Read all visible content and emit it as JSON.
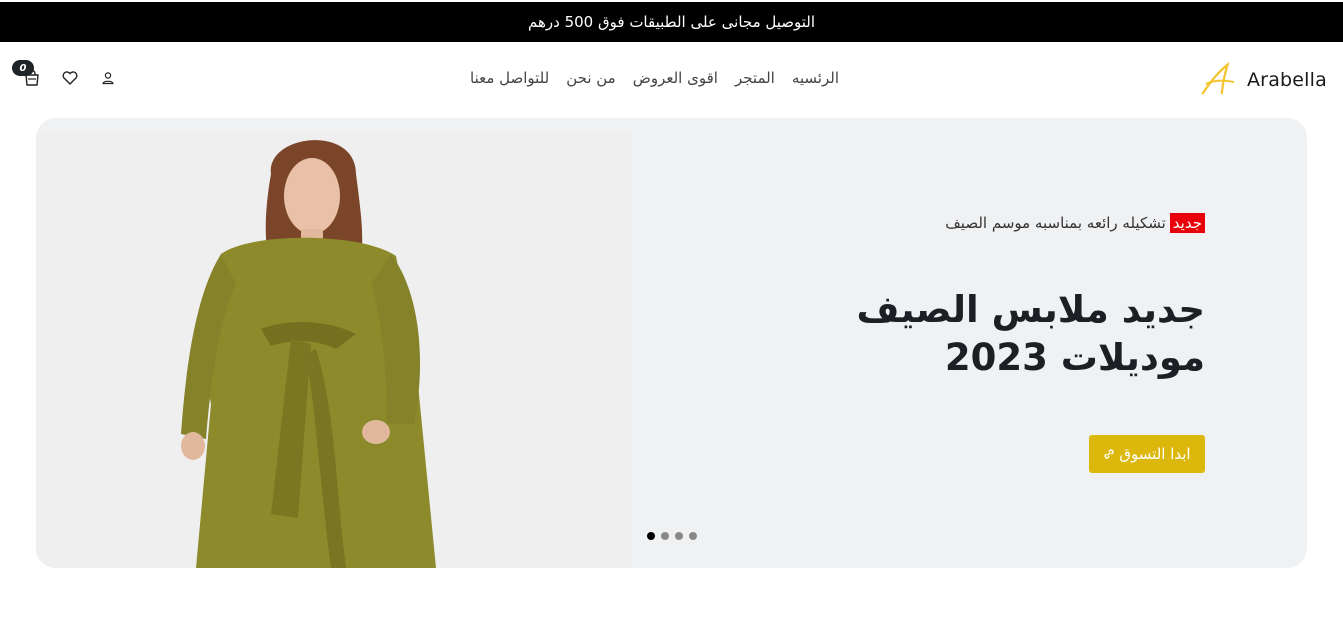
{
  "announcement": {
    "text": "التوصيل مجانى على الطبيقات فوق 500 درهم"
  },
  "brand": {
    "name": "Arabella",
    "accent": "#f2c531"
  },
  "nav": {
    "items": [
      {
        "label": "الرئسيه"
      },
      {
        "label": "المتجر"
      },
      {
        "label": "اقوى العروض"
      },
      {
        "label": "من نحن"
      },
      {
        "label": "للتواصل معنا"
      }
    ]
  },
  "header_icons": {
    "cart": {
      "icon": "shopping-bag-icon",
      "count": "0"
    },
    "wishlist": {
      "icon": "heart-icon"
    },
    "account": {
      "icon": "user-icon"
    }
  },
  "hero": {
    "badge": "جديد",
    "tagline": "تشكيله رائعه بمناسبه موسم الصيف",
    "title_line1": "جديد ملابس الصيف",
    "title_line2": "موديلات 2023",
    "cta_label": "ابدا التسوق",
    "cta_color": "#dcb80c",
    "slides": 4,
    "active_slide": 1
  }
}
